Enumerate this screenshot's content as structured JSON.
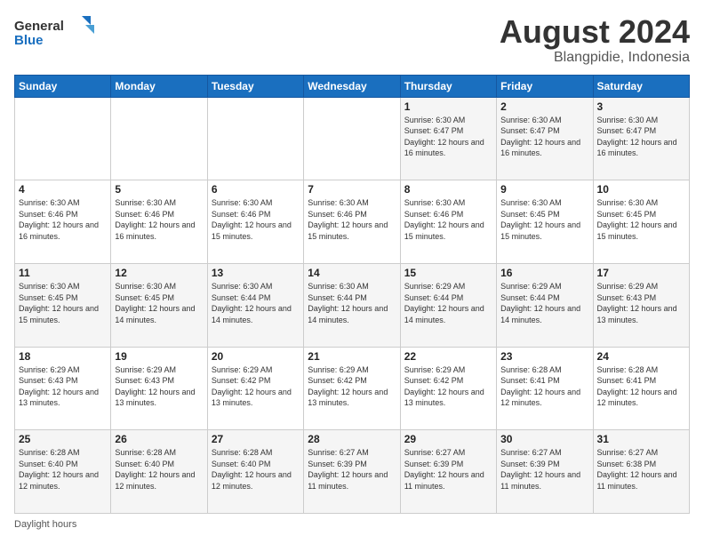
{
  "logo": {
    "line1": "General",
    "line2": "Blue"
  },
  "title": "August 2024",
  "subtitle": "Blangpidie, Indonesia",
  "days_of_week": [
    "Sunday",
    "Monday",
    "Tuesday",
    "Wednesday",
    "Thursday",
    "Friday",
    "Saturday"
  ],
  "footer": "Daylight hours",
  "weeks": [
    [
      {
        "num": "",
        "info": ""
      },
      {
        "num": "",
        "info": ""
      },
      {
        "num": "",
        "info": ""
      },
      {
        "num": "",
        "info": ""
      },
      {
        "num": "1",
        "info": "Sunrise: 6:30 AM\nSunset: 6:47 PM\nDaylight: 12 hours\nand 16 minutes."
      },
      {
        "num": "2",
        "info": "Sunrise: 6:30 AM\nSunset: 6:47 PM\nDaylight: 12 hours\nand 16 minutes."
      },
      {
        "num": "3",
        "info": "Sunrise: 6:30 AM\nSunset: 6:47 PM\nDaylight: 12 hours\nand 16 minutes."
      }
    ],
    [
      {
        "num": "4",
        "info": "Sunrise: 6:30 AM\nSunset: 6:46 PM\nDaylight: 12 hours\nand 16 minutes."
      },
      {
        "num": "5",
        "info": "Sunrise: 6:30 AM\nSunset: 6:46 PM\nDaylight: 12 hours\nand 16 minutes."
      },
      {
        "num": "6",
        "info": "Sunrise: 6:30 AM\nSunset: 6:46 PM\nDaylight: 12 hours\nand 15 minutes."
      },
      {
        "num": "7",
        "info": "Sunrise: 6:30 AM\nSunset: 6:46 PM\nDaylight: 12 hours\nand 15 minutes."
      },
      {
        "num": "8",
        "info": "Sunrise: 6:30 AM\nSunset: 6:46 PM\nDaylight: 12 hours\nand 15 minutes."
      },
      {
        "num": "9",
        "info": "Sunrise: 6:30 AM\nSunset: 6:45 PM\nDaylight: 12 hours\nand 15 minutes."
      },
      {
        "num": "10",
        "info": "Sunrise: 6:30 AM\nSunset: 6:45 PM\nDaylight: 12 hours\nand 15 minutes."
      }
    ],
    [
      {
        "num": "11",
        "info": "Sunrise: 6:30 AM\nSunset: 6:45 PM\nDaylight: 12 hours\nand 15 minutes."
      },
      {
        "num": "12",
        "info": "Sunrise: 6:30 AM\nSunset: 6:45 PM\nDaylight: 12 hours\nand 14 minutes."
      },
      {
        "num": "13",
        "info": "Sunrise: 6:30 AM\nSunset: 6:44 PM\nDaylight: 12 hours\nand 14 minutes."
      },
      {
        "num": "14",
        "info": "Sunrise: 6:30 AM\nSunset: 6:44 PM\nDaylight: 12 hours\nand 14 minutes."
      },
      {
        "num": "15",
        "info": "Sunrise: 6:29 AM\nSunset: 6:44 PM\nDaylight: 12 hours\nand 14 minutes."
      },
      {
        "num": "16",
        "info": "Sunrise: 6:29 AM\nSunset: 6:44 PM\nDaylight: 12 hours\nand 14 minutes."
      },
      {
        "num": "17",
        "info": "Sunrise: 6:29 AM\nSunset: 6:43 PM\nDaylight: 12 hours\nand 13 minutes."
      }
    ],
    [
      {
        "num": "18",
        "info": "Sunrise: 6:29 AM\nSunset: 6:43 PM\nDaylight: 12 hours\nand 13 minutes."
      },
      {
        "num": "19",
        "info": "Sunrise: 6:29 AM\nSunset: 6:43 PM\nDaylight: 12 hours\nand 13 minutes."
      },
      {
        "num": "20",
        "info": "Sunrise: 6:29 AM\nSunset: 6:42 PM\nDaylight: 12 hours\nand 13 minutes."
      },
      {
        "num": "21",
        "info": "Sunrise: 6:29 AM\nSunset: 6:42 PM\nDaylight: 12 hours\nand 13 minutes."
      },
      {
        "num": "22",
        "info": "Sunrise: 6:29 AM\nSunset: 6:42 PM\nDaylight: 12 hours\nand 13 minutes."
      },
      {
        "num": "23",
        "info": "Sunrise: 6:28 AM\nSunset: 6:41 PM\nDaylight: 12 hours\nand 12 minutes."
      },
      {
        "num": "24",
        "info": "Sunrise: 6:28 AM\nSunset: 6:41 PM\nDaylight: 12 hours\nand 12 minutes."
      }
    ],
    [
      {
        "num": "25",
        "info": "Sunrise: 6:28 AM\nSunset: 6:40 PM\nDaylight: 12 hours\nand 12 minutes."
      },
      {
        "num": "26",
        "info": "Sunrise: 6:28 AM\nSunset: 6:40 PM\nDaylight: 12 hours\nand 12 minutes."
      },
      {
        "num": "27",
        "info": "Sunrise: 6:28 AM\nSunset: 6:40 PM\nDaylight: 12 hours\nand 12 minutes."
      },
      {
        "num": "28",
        "info": "Sunrise: 6:27 AM\nSunset: 6:39 PM\nDaylight: 12 hours\nand 11 minutes."
      },
      {
        "num": "29",
        "info": "Sunrise: 6:27 AM\nSunset: 6:39 PM\nDaylight: 12 hours\nand 11 minutes."
      },
      {
        "num": "30",
        "info": "Sunrise: 6:27 AM\nSunset: 6:39 PM\nDaylight: 12 hours\nand 11 minutes."
      },
      {
        "num": "31",
        "info": "Sunrise: 6:27 AM\nSunset: 6:38 PM\nDaylight: 12 hours\nand 11 minutes."
      }
    ]
  ]
}
